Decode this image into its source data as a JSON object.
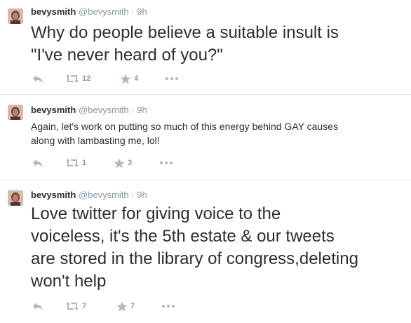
{
  "tweets": [
    {
      "fullname": "bevysmith",
      "screenname": "@bevysmith",
      "separator": "·",
      "time": "9h",
      "text": "Why do people believe a suitable insult is\n\"I've never heard of you?\"",
      "retweets": "12",
      "favorites": "4"
    },
    {
      "fullname": "bevysmith",
      "screenname": "@bevysmith",
      "separator": "·",
      "time": "9h",
      "text": "Again, let's work on putting so much of this energy behind GAY causes\nalong with lambasting me, lol!",
      "retweets": "1",
      "favorites": "3"
    },
    {
      "fullname": "bevysmith",
      "screenname": "@bevysmith",
      "separator": "·",
      "time": "9h",
      "text": "Love twitter for giving voice to the\nvoiceless, it's the 5th estate & our tweets\nare stored in the library of congress,deleting\nwon't help",
      "retweets": "7",
      "favorites": "7"
    }
  ],
  "icons": {
    "reply": "reply-icon",
    "retweet": "retweet-icon",
    "favorite": "star-icon",
    "more": "more-icon"
  },
  "colors": {
    "text": "#292f33",
    "meta": "#8899a6",
    "action": "#aab8c2",
    "divider": "#e1e8ed"
  }
}
